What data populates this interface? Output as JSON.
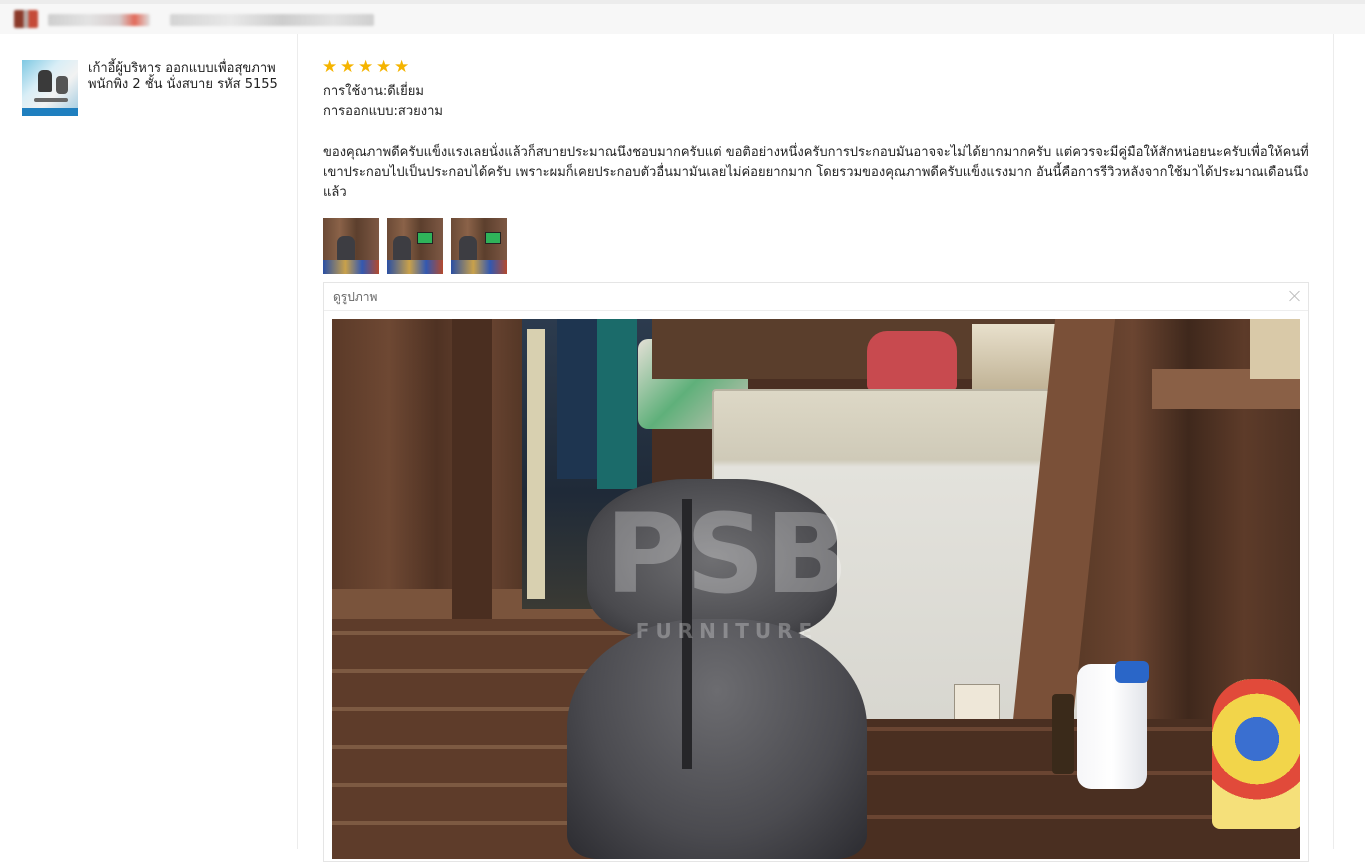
{
  "review": {
    "product": {
      "title": "เก้าอี้ผู้บริหาร ออกแบบเพื่อสุขภาพ พนักพิง 2 ชั้น นั่งสบาย รหัส 5155"
    },
    "stars_filled": 5,
    "stars_total": 5,
    "attributes": [
      {
        "label": "การใช้งาน:ดีเยี่ยม"
      },
      {
        "label": "การออกแบบ:สวยงาม"
      }
    ],
    "text": "ของคุณภาพดีครับแข็งแรงเลยนั่งแล้วก็สบายประมาณนึงชอบมากครับแต่ ขอติอย่างหนึ่งครับการประกอบมันอาจจะไม่ได้ยากมากครับ แต่ควรจะมีคู่มือให้สักหน่อยนะครับเพื่อให้คนที่เขาประกอบไปเป็นประกอบได้ครับ เพราะผมก็เคยประกอบตัวอื่นมามันเลยไม่ค่อยยากมาก โดยรวมของคุณภาพดีครับแข็งแรงมาก อันนี้คือการรีวิวหลังจากใช้มาได้ประมาณเดือนนึงแล้ว",
    "photos_count": 3,
    "viewer": {
      "title": "ดูรูปภาพ",
      "watermark_main": "PSB",
      "watermark_sub": "FURNITURE"
    }
  },
  "colors": {
    "star": "#f5b400",
    "border": "#ececec",
    "text": "#222222"
  }
}
